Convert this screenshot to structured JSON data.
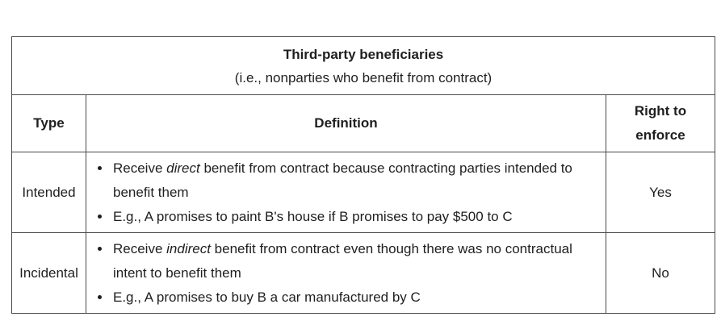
{
  "title": "Third-party beneficiaries",
  "subtitle": "(i.e., nonparties who benefit from contract)",
  "headers": {
    "type": "Type",
    "definition": "Definition",
    "right_line1": "Right to",
    "right_line2": "enforce"
  },
  "rows": [
    {
      "type": "Intended",
      "bullet1_pre": "Receive ",
      "bullet1_em": "direct",
      "bullet1_post": " benefit from contract because contracting parties intended to benefit them",
      "bullet2": "E.g., A promises to paint B's house if B promises to pay $500 to C",
      "right": "Yes"
    },
    {
      "type": "Incidental",
      "bullet1_pre": "Receive ",
      "bullet1_em": "indirect",
      "bullet1_post": " benefit from contract even though there was no contractual intent to benefit them",
      "bullet2": "E.g., A promises to buy B a car manufactured by C",
      "right": "No"
    }
  ]
}
